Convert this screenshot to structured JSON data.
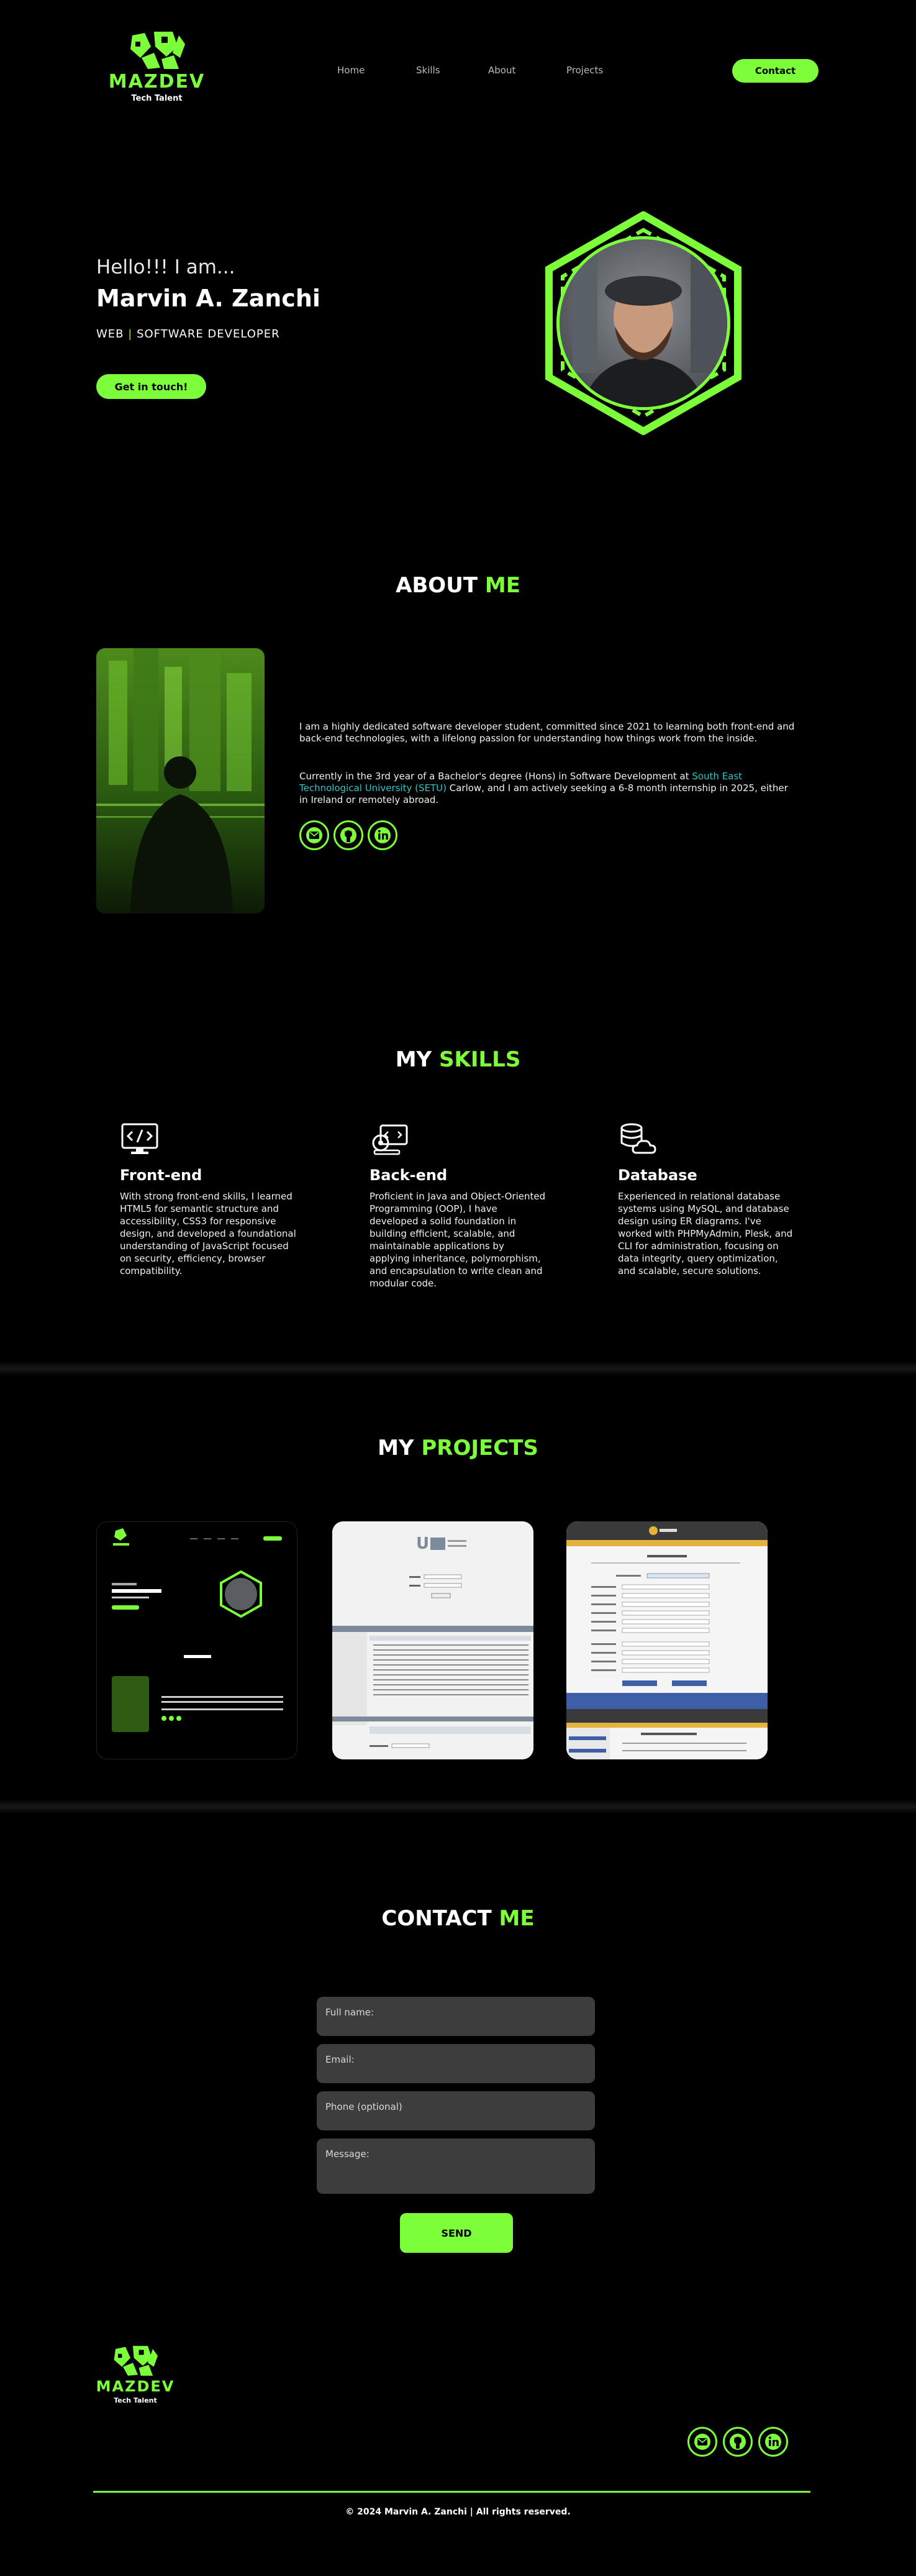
{
  "brand": {
    "name": "MAZDEV",
    "tagline": "Tech Talent"
  },
  "nav": {
    "items": [
      "Home",
      "Skills",
      "About",
      "Projects"
    ],
    "contact_label": "Contact"
  },
  "hero": {
    "greeting": "Hello!!! I am...",
    "name": "Marvin A. Zanchi",
    "role_left": "WEB",
    "role_sep": "|",
    "role_right": "SOFTWARE DEVELOPER",
    "cta_label": "Get in touch!"
  },
  "about": {
    "title_white": "ABOUT",
    "title_green": "ME",
    "p1": "I am a highly dedicated software developer student, committed since 2021 to learning both front-end and back-end technologies, with a lifelong passion for understanding how things work from the inside.",
    "p2_a": "Currently in the 3rd year of a Bachelor's degree (Hons) in Software Development at ",
    "p2_link": "South East Technological University (SETU)",
    "p2_b": " Carlow, and I am actively seeking a 6-8 month internship in 2025, either in Ireland or remotely abroad.",
    "icons": [
      "email-icon",
      "github-icon",
      "linkedin-icon"
    ]
  },
  "skills": {
    "title_white": "MY",
    "title_green": "SKILLS",
    "items": [
      {
        "icon": "code-monitor-icon",
        "title": "Front-end",
        "text": "With strong front-end skills, I learned HTML5 for semantic structure and accessibility, CSS3 for responsive design, and developed a foundational understanding of JavaScript focused on security, efficiency, browser compatibility."
      },
      {
        "icon": "server-gear-icon",
        "title": "Back-end",
        "text": "Proficient in Java and Object-Oriented Programming (OOP), I have developed a solid foundation in building efficient, scalable, and maintainable applications by applying inheritance, polymorphism, and encapsulation to write clean and modular code."
      },
      {
        "icon": "database-cloud-icon",
        "title": "Database",
        "text": "Experienced in relational database systems using MySQL, and database design using ER diagrams. I've worked with PHPMyAdmin, Plesk, and CLI for administration, focusing on data integrity, query optimization, and scalable, secure solutions."
      }
    ]
  },
  "projects": {
    "title_white": "MY",
    "title_green": "PROJECTS"
  },
  "contact": {
    "title_white": "CONTACT",
    "title_green": "ME",
    "fields": {
      "name": "Full name:",
      "email": "Email:",
      "phone": "Phone (optional)",
      "message": "Message:"
    },
    "send_label": "SEND"
  },
  "footer": {
    "copyright": "© 2024 Marvin A. Zanchi | All rights reserved."
  },
  "colors": {
    "accent": "#7cff3a",
    "background": "#000000",
    "field": "#3d3d3d",
    "link": "#2fc6c6"
  }
}
